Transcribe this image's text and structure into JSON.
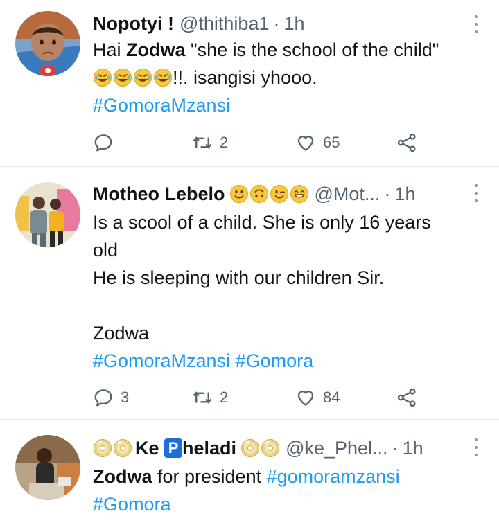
{
  "tweets": [
    {
      "name": "Nopotyi !",
      "handle": "@thithiba1",
      "time": "1h",
      "body": {
        "l1_pre": "Hai ",
        "l1_bold": "Zodwa",
        "l1_post": " \"she is the school of the child\"",
        "l2_post": "!!. isangisi yhooo.",
        "l3_tag": "#GomoraMzansi"
      },
      "reply_count": "",
      "retweet_count": "2",
      "like_count": "65"
    },
    {
      "name": "Motheo Lebelo",
      "handle": "@Mot...",
      "time": "1h",
      "body": {
        "l1": "Is a scool of a child. She is only 16 years",
        "l2": "old",
        "l3": "He is sleeping with our children Sir.",
        "l5": "Zodwa",
        "l6_tag1": "#GomoraMzansi",
        "l6_tag2": "#Gomora"
      },
      "reply_count": "3",
      "retweet_count": "2",
      "like_count": "84"
    },
    {
      "name_part1": "Ke",
      "name_badge": "P",
      "name_part2": "heladi",
      "handle": "@ke_Phel...",
      "time": "1h",
      "body": {
        "l1_bold": "Zodwa",
        "l1_mid": " for president ",
        "l1_tag": "#gomoramzansi",
        "l2_tag": "#Gomora"
      }
    }
  ],
  "icons": {
    "reply": "reply-icon",
    "retweet": "retweet-icon",
    "like": "like-icon",
    "share": "share-icon",
    "more": "more-icon"
  },
  "colors": {
    "link": "#1d9bf0",
    "secondary_text": "#536471",
    "icon": "#536471",
    "divider": "#e6ecf0"
  }
}
